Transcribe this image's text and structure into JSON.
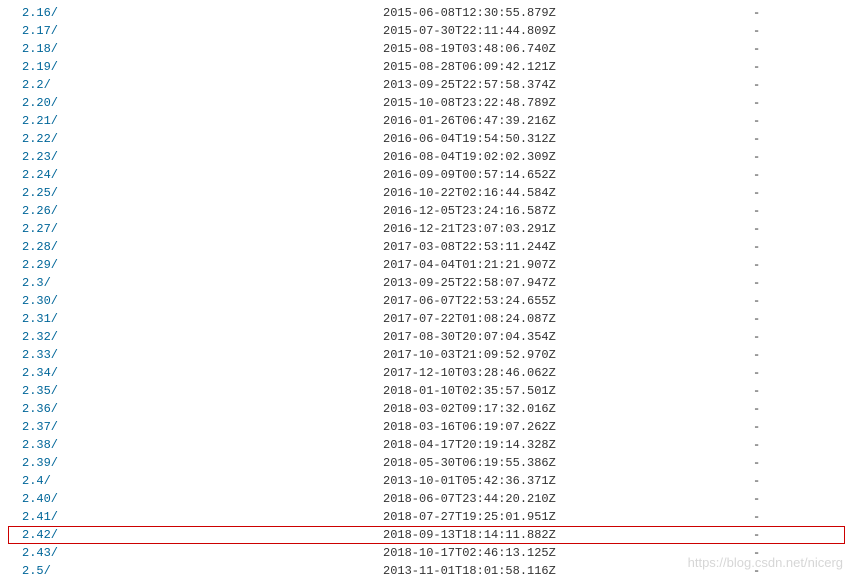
{
  "watermark": "https://blog.csdn.net/nicerg",
  "listing": [
    {
      "name": "2.16/",
      "date": "2015-06-08T12:30:55.879Z",
      "size": "-",
      "highlighted": false
    },
    {
      "name": "2.17/",
      "date": "2015-07-30T22:11:44.809Z",
      "size": "-",
      "highlighted": false
    },
    {
      "name": "2.18/",
      "date": "2015-08-19T03:48:06.740Z",
      "size": "-",
      "highlighted": false
    },
    {
      "name": "2.19/",
      "date": "2015-08-28T06:09:42.121Z",
      "size": "-",
      "highlighted": false
    },
    {
      "name": "2.2/",
      "date": "2013-09-25T22:57:58.374Z",
      "size": "-",
      "highlighted": false
    },
    {
      "name": "2.20/",
      "date": "2015-10-08T23:22:48.789Z",
      "size": "-",
      "highlighted": false
    },
    {
      "name": "2.21/",
      "date": "2016-01-26T06:47:39.216Z",
      "size": "-",
      "highlighted": false
    },
    {
      "name": "2.22/",
      "date": "2016-06-04T19:54:50.312Z",
      "size": "-",
      "highlighted": false
    },
    {
      "name": "2.23/",
      "date": "2016-08-04T19:02:02.309Z",
      "size": "-",
      "highlighted": false
    },
    {
      "name": "2.24/",
      "date": "2016-09-09T00:57:14.652Z",
      "size": "-",
      "highlighted": false
    },
    {
      "name": "2.25/",
      "date": "2016-10-22T02:16:44.584Z",
      "size": "-",
      "highlighted": false
    },
    {
      "name": "2.26/",
      "date": "2016-12-05T23:24:16.587Z",
      "size": "-",
      "highlighted": false
    },
    {
      "name": "2.27/",
      "date": "2016-12-21T23:07:03.291Z",
      "size": "-",
      "highlighted": false
    },
    {
      "name": "2.28/",
      "date": "2017-03-08T22:53:11.244Z",
      "size": "-",
      "highlighted": false
    },
    {
      "name": "2.29/",
      "date": "2017-04-04T01:21:21.907Z",
      "size": "-",
      "highlighted": false
    },
    {
      "name": "2.3/",
      "date": "2013-09-25T22:58:07.947Z",
      "size": "-",
      "highlighted": false
    },
    {
      "name": "2.30/",
      "date": "2017-06-07T22:53:24.655Z",
      "size": "-",
      "highlighted": false
    },
    {
      "name": "2.31/",
      "date": "2017-07-22T01:08:24.087Z",
      "size": "-",
      "highlighted": false
    },
    {
      "name": "2.32/",
      "date": "2017-08-30T20:07:04.354Z",
      "size": "-",
      "highlighted": false
    },
    {
      "name": "2.33/",
      "date": "2017-10-03T21:09:52.970Z",
      "size": "-",
      "highlighted": false
    },
    {
      "name": "2.34/",
      "date": "2017-12-10T03:28:46.062Z",
      "size": "-",
      "highlighted": false
    },
    {
      "name": "2.35/",
      "date": "2018-01-10T02:35:57.501Z",
      "size": "-",
      "highlighted": false
    },
    {
      "name": "2.36/",
      "date": "2018-03-02T09:17:32.016Z",
      "size": "-",
      "highlighted": false
    },
    {
      "name": "2.37/",
      "date": "2018-03-16T06:19:07.262Z",
      "size": "-",
      "highlighted": false
    },
    {
      "name": "2.38/",
      "date": "2018-04-17T20:19:14.328Z",
      "size": "-",
      "highlighted": false
    },
    {
      "name": "2.39/",
      "date": "2018-05-30T06:19:55.386Z",
      "size": "-",
      "highlighted": false
    },
    {
      "name": "2.4/",
      "date": "2013-10-01T05:42:36.371Z",
      "size": "-",
      "highlighted": false
    },
    {
      "name": "2.40/",
      "date": "2018-06-07T23:44:20.210Z",
      "size": "-",
      "highlighted": false
    },
    {
      "name": "2.41/",
      "date": "2018-07-27T19:25:01.951Z",
      "size": "-",
      "highlighted": false
    },
    {
      "name": "2.42/",
      "date": "2018-09-13T18:14:11.882Z",
      "size": "-",
      "highlighted": true
    },
    {
      "name": "2.43/",
      "date": "2018-10-17T02:46:13.125Z",
      "size": "-",
      "highlighted": false
    },
    {
      "name": "2.5/",
      "date": "2013-11-01T18:01:58.116Z",
      "size": "-",
      "highlighted": false
    }
  ]
}
